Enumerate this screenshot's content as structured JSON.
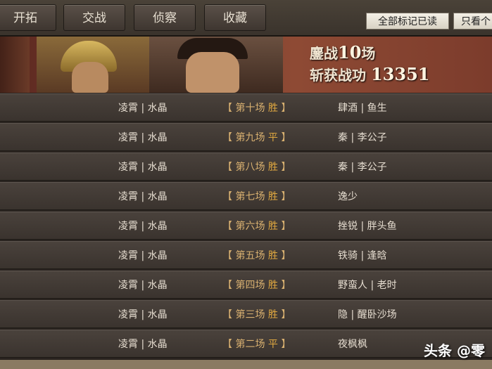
{
  "tabs": [
    "开拓",
    "交战",
    "侦察",
    "收藏"
  ],
  "buttons": {
    "read_all": "全部标记已读",
    "view_only": "只看个"
  },
  "banner": {
    "battles_label": "鏖战",
    "battles_value": "10",
    "battles_unit": "场",
    "merit_label": "斩获战功",
    "merit_value": "13351"
  },
  "rows": [
    {
      "left": "凌霄 | 水晶",
      "round": "第十场",
      "result": "胜",
      "right": "肆酒 | 鱼生"
    },
    {
      "left": "凌霄 | 水晶",
      "round": "第九场",
      "result": "平",
      "right": "秦 | 李公子"
    },
    {
      "left": "凌霄 | 水晶",
      "round": "第八场",
      "result": "胜",
      "right": "秦 | 李公子"
    },
    {
      "left": "凌霄 | 水晶",
      "round": "第七场",
      "result": "胜",
      "right": "逸少"
    },
    {
      "left": "凌霄 | 水晶",
      "round": "第六场",
      "result": "胜",
      "right": "挫锐 | 胖头鱼"
    },
    {
      "left": "凌霄 | 水晶",
      "round": "第五场",
      "result": "胜",
      "right": "铁骑 | 逢晗"
    },
    {
      "left": "凌霄 | 水晶",
      "round": "第四场",
      "result": "胜",
      "right": "野蛮人 | 老时"
    },
    {
      "left": "凌霄 | 水晶",
      "round": "第三场",
      "result": "胜",
      "right": "隐 | 醒卧沙场"
    },
    {
      "left": "凌霄 | 水晶",
      "round": "第二场",
      "result": "平",
      "right": "夜枫枫"
    }
  ],
  "watermark": "头条 @零"
}
